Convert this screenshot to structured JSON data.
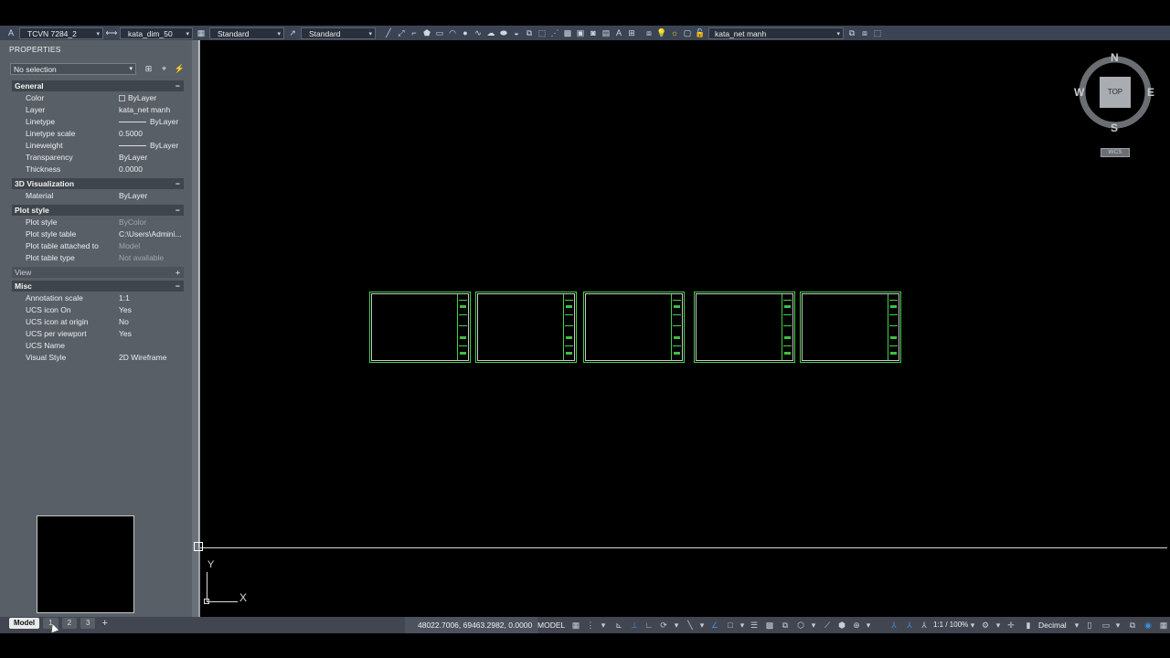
{
  "toolbar": {
    "text_style": "TCVN 7284_2",
    "dim_style": "kata_dim_50",
    "table_style": "Standard",
    "multileader_style": "Standard",
    "layer": "kata_net manh"
  },
  "properties": {
    "title": "PROPERTIES",
    "selection": "No selection",
    "sections": {
      "general": {
        "label": "General",
        "toggle": "−"
      },
      "viz": {
        "label": "3D Visualization",
        "toggle": "−"
      },
      "plot": {
        "label": "Plot style",
        "toggle": "−"
      },
      "view": {
        "label": "View",
        "toggle": "+"
      },
      "misc": {
        "label": "Misc",
        "toggle": "−"
      }
    },
    "general": [
      {
        "label": "Color",
        "value": "ByLayer"
      },
      {
        "label": "Layer",
        "value": "kata_net manh"
      },
      {
        "label": "Linetype",
        "value": "ByLayer"
      },
      {
        "label": "Linetype scale",
        "value": "0.5000"
      },
      {
        "label": "Lineweight",
        "value": "ByLayer"
      },
      {
        "label": "Transparency",
        "value": "ByLayer"
      },
      {
        "label": "Thickness",
        "value": "0.0000"
      }
    ],
    "viz": [
      {
        "label": "Material",
        "value": "ByLayer"
      }
    ],
    "plot": [
      {
        "label": "Plot style",
        "value": "ByColor"
      },
      {
        "label": "Plot style table",
        "value": "C:\\Users\\Admini..."
      },
      {
        "label": "Plot table attached to",
        "value": "Model"
      },
      {
        "label": "Plot table type",
        "value": "Not available"
      }
    ],
    "misc": [
      {
        "label": "Annotation scale",
        "value": "1:1"
      },
      {
        "label": "UCS icon On",
        "value": "Yes"
      },
      {
        "label": "UCS icon at origin",
        "value": "No"
      },
      {
        "label": "UCS per viewport",
        "value": "Yes"
      },
      {
        "label": "UCS Name",
        "value": ""
      },
      {
        "label": "Visual Style",
        "value": "2D Wireframe"
      }
    ]
  },
  "viewcube": {
    "n": "N",
    "s": "S",
    "e": "E",
    "w": "W",
    "face": "TOP",
    "wcs": "WCS"
  },
  "ucs": {
    "x": "X",
    "y": "Y"
  },
  "layout_tabs": {
    "model": "Model",
    "t1": "1",
    "t2": "2",
    "t3": "3",
    "add": "+"
  },
  "status": {
    "coords": "48022.7006, 69463.2982, 0.0000",
    "mode": "MODEL",
    "scale": "1:1 / 100%",
    "units": "Decimal"
  },
  "colors": {
    "sheet_frame": "#43d14a",
    "panel_bg": "#595f66",
    "toolbar_bg": "#3b4453"
  }
}
